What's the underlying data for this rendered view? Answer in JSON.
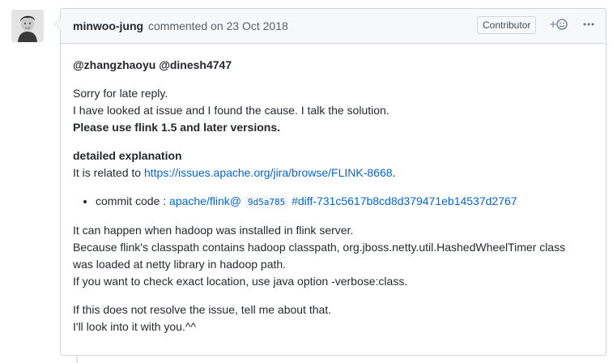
{
  "comment": {
    "author": "minwoo-jung",
    "header_text": "commented on 23 Oct 2018",
    "badge": "Contributor",
    "reaction_label": "+☺",
    "more_label": "•••",
    "mentions": [
      "@zhangzhaoyu",
      "@dinesh4747"
    ],
    "p1_line1": "Sorry for late reply.",
    "p1_line2": "I have looked at issue and I found the cause. I talk the solution.",
    "p1_line3": "Please use flink 1.5 and later versions.",
    "p2_heading": "detailed explanation",
    "p2_prefix": "It is related to ",
    "p2_link": "https://issues.apache.org/jira/browse/FLINK-8668",
    "p2_suffix": ".",
    "commit_prefix": "commit code : ",
    "commit_repo": "apache/flink@",
    "commit_sha": "9d5a785",
    "commit_diff": "#diff-731c5617b8cd8d379471eb14537d2767",
    "p3_line1": "It can happen when hadoop was installed in flink server.",
    "p3_line2": "Because flink's classpath contains hadoop classpath, org.jboss.netty.util.HashedWheelTimer class",
    "p3_line3": "was loaded at netty library in hadoop path.",
    "p3_line4": "If you want to check exact location, use java option -verbose:class.",
    "p4_line1": "If this does not resolve the issue, tell me about that.",
    "p4_line2": "I'll look into it with you.^^"
  }
}
